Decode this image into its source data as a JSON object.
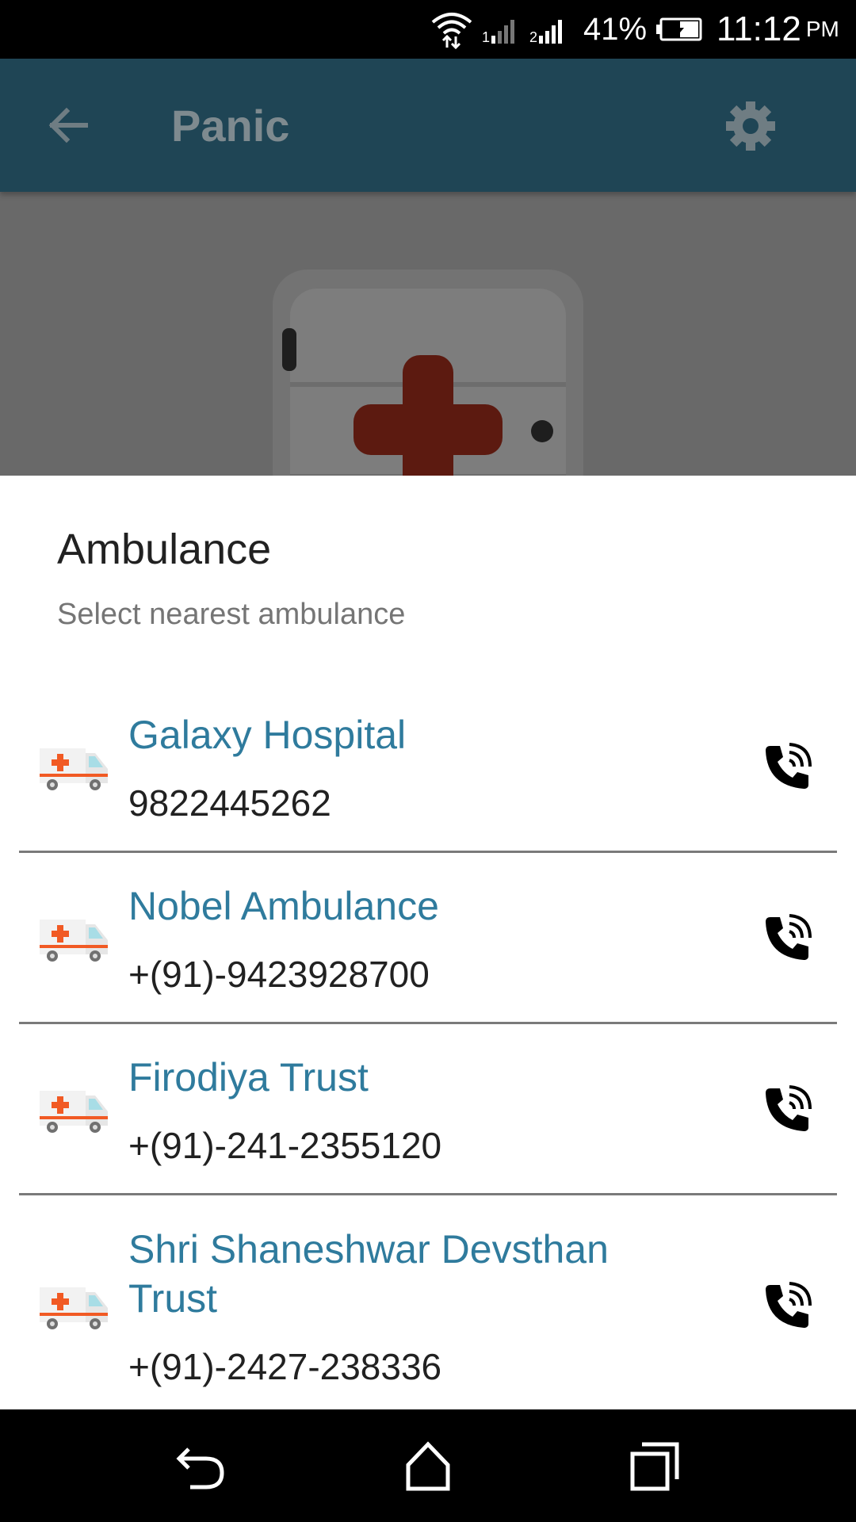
{
  "status_bar": {
    "battery_percent": "41%",
    "time": "11:12",
    "ampm": "PM",
    "icons": [
      "wifi-icon",
      "signal-icon",
      "signal-icon",
      "battery-charging-icon"
    ]
  },
  "toolbar": {
    "title": "Panic",
    "back_icon": "arrow-left-icon",
    "settings_icon": "gear-icon"
  },
  "dialog": {
    "title": "Ambulance",
    "subtitle": "Select nearest ambulance",
    "items": [
      {
        "name": "Galaxy Hospital",
        "phone": "9822445262"
      },
      {
        "name": "Nobel Ambulance",
        "phone": "+(91)-9423928700"
      },
      {
        "name": "Firodiya Trust",
        "phone": "+(91)-241-2355120"
      },
      {
        "name": "Shri Shaneshwar Devsthan Trust",
        "phone": "+(91)-2427-238336"
      }
    ]
  },
  "nav_bar": {
    "icons": [
      "back-icon",
      "home-icon",
      "recent-apps-icon"
    ]
  },
  "colors": {
    "toolbar": "#1f4555",
    "item_name": "#2f7b9d",
    "cross": "#5c1a10",
    "ambulance_cross": "#f15a24"
  }
}
